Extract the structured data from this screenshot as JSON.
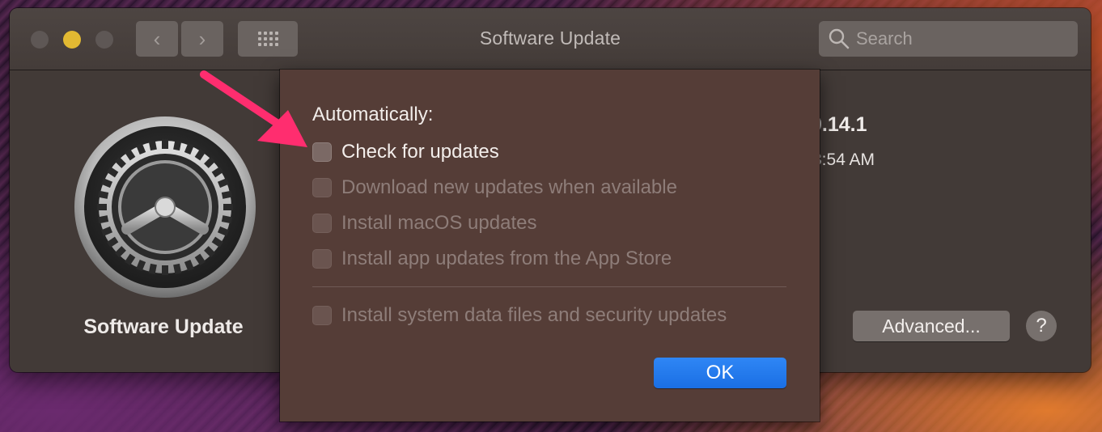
{
  "window": {
    "title": "Software Update",
    "search_placeholder": "Search"
  },
  "toolbar": {
    "back_icon": "‹",
    "forward_icon": "›"
  },
  "pane": {
    "label": "Software Update",
    "version_fragment": "0.14.1",
    "time_fragment": "3:54 AM",
    "advanced_label": "Advanced...",
    "help_label": "?"
  },
  "sheet": {
    "heading": "Automatically:",
    "options": [
      {
        "label": "Check for updates",
        "enabled": true,
        "checked": false
      },
      {
        "label": "Download new updates when available",
        "enabled": false,
        "checked": false
      },
      {
        "label": "Install macOS updates",
        "enabled": false,
        "checked": false
      },
      {
        "label": "Install app updates from the App Store",
        "enabled": false,
        "checked": false
      }
    ],
    "extra_option": {
      "label": "Install system data files and security updates",
      "enabled": false,
      "checked": false
    },
    "ok_label": "OK"
  },
  "colors": {
    "accent": "#1a6fe4",
    "annotation_arrow": "#ff2d6f",
    "traffic_minimize": "#e2b932"
  }
}
